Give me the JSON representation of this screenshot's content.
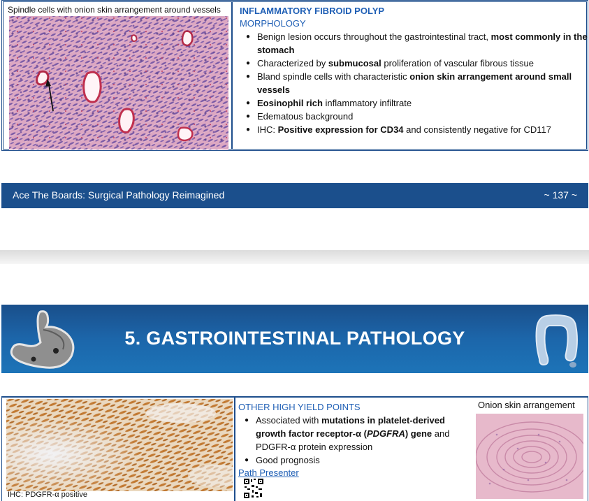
{
  "top_section": {
    "image_caption": "Spindle cells with onion skin arrangement around vessels",
    "title": "INFLAMMATORY FIBROID POLYP",
    "subtitle": "MORPHOLOGY",
    "bullets": [
      [
        {
          "t": "Benign lesion occurs throughout the gastrointestinal tract, ",
          "b": false
        },
        {
          "t": "most commonly in the stomach",
          "b": true
        }
      ],
      [
        {
          "t": "Characterized by ",
          "b": false
        },
        {
          "t": "submucosal",
          "b": true
        },
        {
          "t": " proliferation of vascular fibrous tissue",
          "b": false
        }
      ],
      [
        {
          "t": "Bland spindle cells with characteristic ",
          "b": false
        },
        {
          "t": "onion skin arrangement around small vessels",
          "b": true
        }
      ],
      [
        {
          "t": "Eosinophil rich",
          "b": true
        },
        {
          "t": " inflammatory infiltrate",
          "b": false
        }
      ],
      [
        {
          "t": "Edematous background",
          "b": false
        }
      ],
      [
        {
          "t": "IHC: ",
          "b": false
        },
        {
          "t": "Positive expression for CD34",
          "b": true
        },
        {
          "t": " and consistently negative for CD117",
          "b": false
        }
      ]
    ]
  },
  "footer": {
    "title": "Ace The Boards: Surgical Pathology Reimagined",
    "page": "~ 137 ~"
  },
  "chapter": {
    "title": "5. GASTROINTESTINAL PATHOLOGY",
    "left_icon": "stomach-icon",
    "right_icon": "colon-icon"
  },
  "bottom_section": {
    "ihc_caption": "IHC: PDGFR-α positive",
    "title": "OTHER HIGH YIELD POINTS",
    "bullets": [
      [
        {
          "t": "Associated with ",
          "b": false
        },
        {
          "t": "mutations in platelet-derived growth factor receptor-α (",
          "b": true
        },
        {
          "t": "PDGFRA",
          "b": true,
          "i": true
        },
        {
          "t": ") gene",
          "b": true
        },
        {
          "t": " and PDGFR-α protein expression",
          "b": false
        }
      ],
      [
        {
          "t": "Good prognosis",
          "b": false
        }
      ]
    ],
    "link_text": "Path Presenter",
    "onion_caption": "Onion skin arrangement"
  },
  "colors": {
    "accent_blue": "#1f5fb5",
    "bar_blue": "#1b4f8c",
    "he_pink": "#d9a0bd",
    "ihc_brown": "#c6843c"
  }
}
